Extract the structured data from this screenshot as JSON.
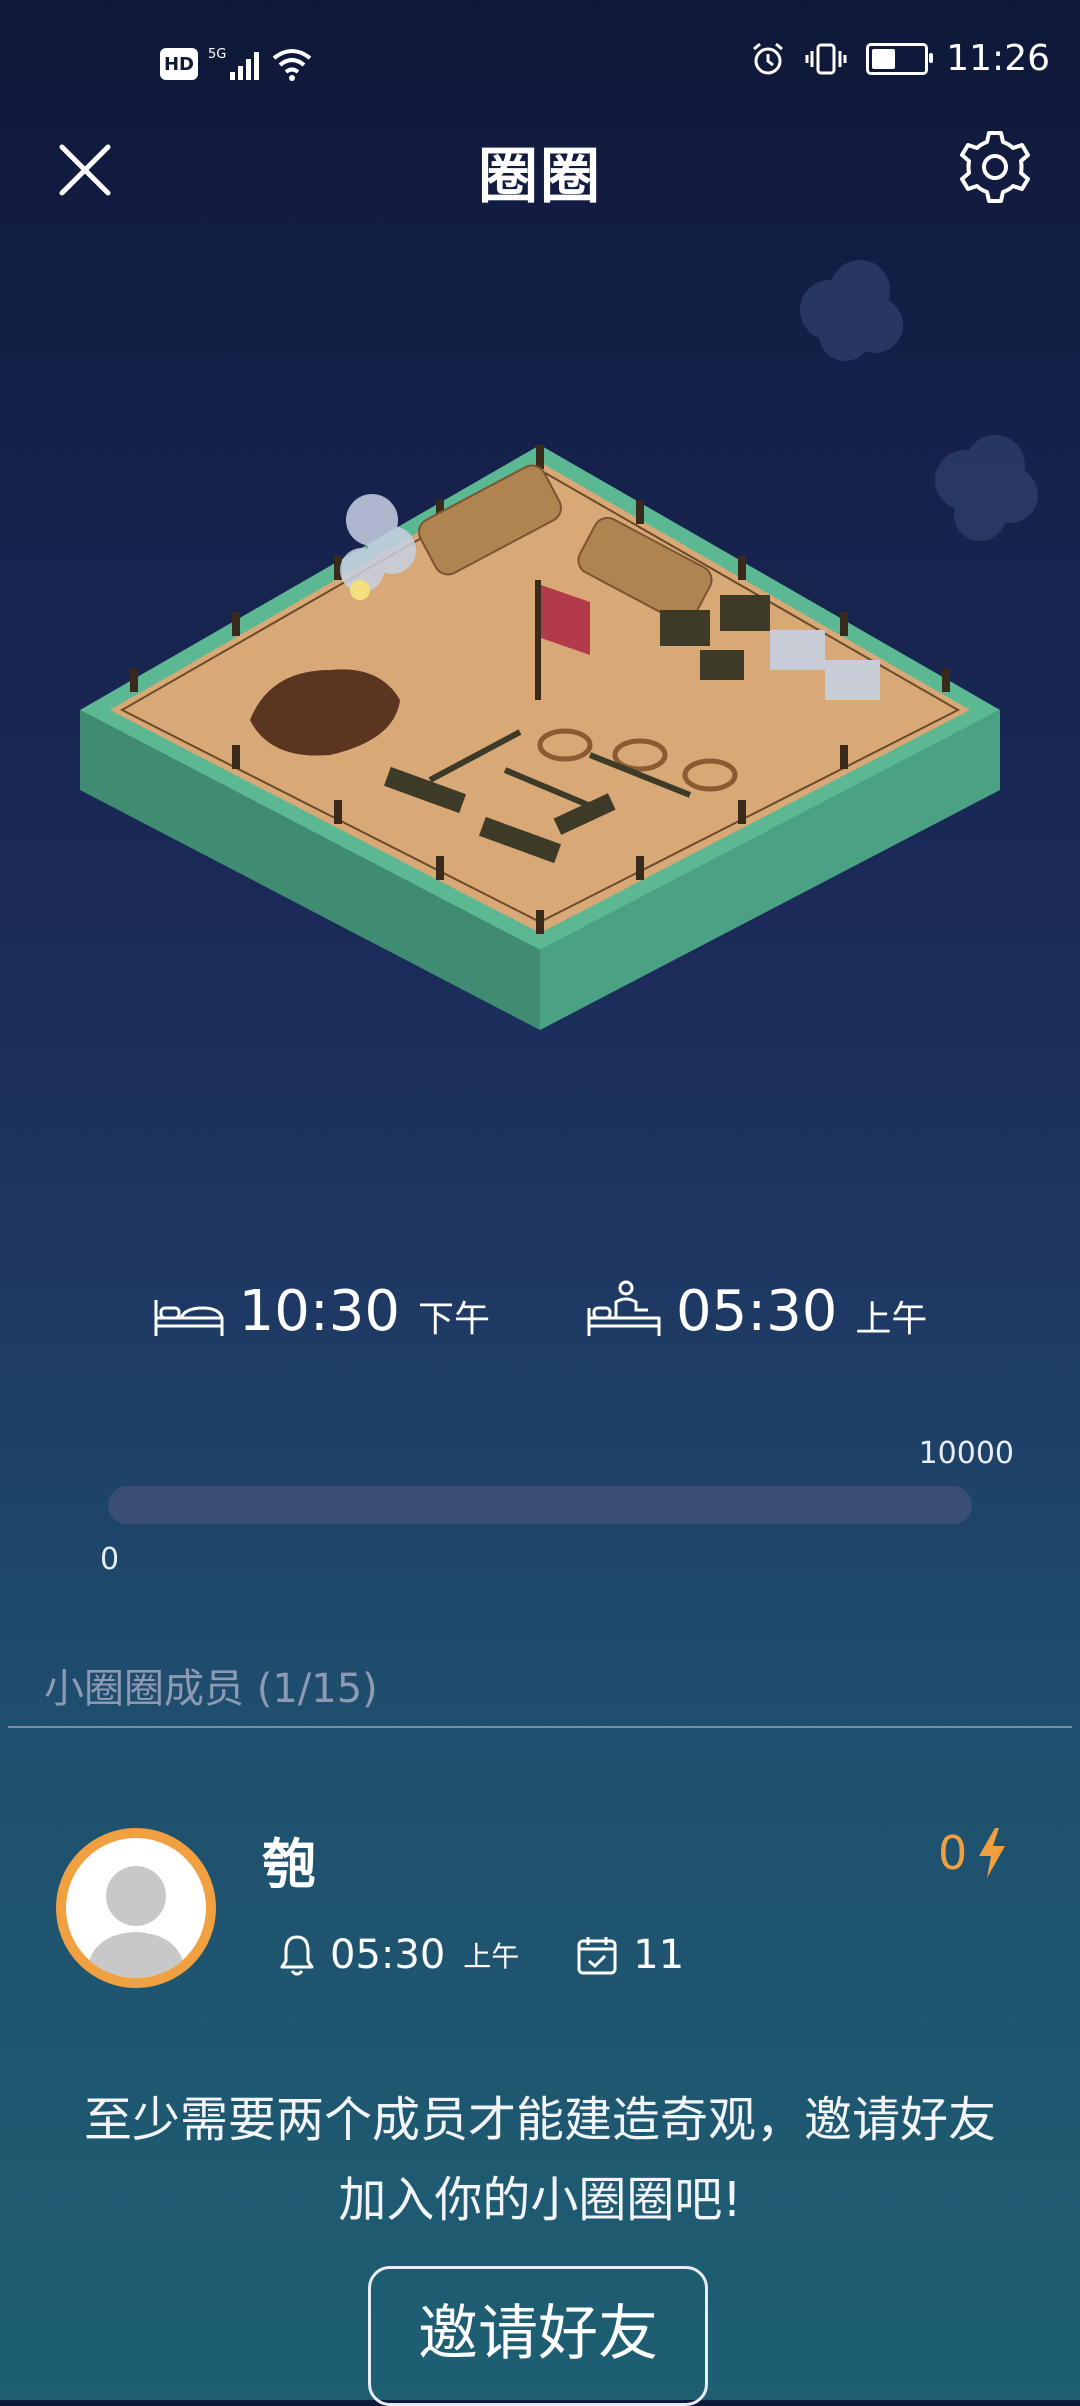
{
  "status_bar": {
    "hd_label": "HD",
    "network": "5G",
    "time": "11:26",
    "battery_level": 0.45
  },
  "header": {
    "title": "圈圈",
    "close_icon": "close-icon",
    "settings_icon": "gear-icon"
  },
  "sleep": {
    "bedtime": {
      "time": "10:30",
      "ampm": "下午",
      "icon": "bed-icon"
    },
    "wakeup": {
      "time": "05:30",
      "ampm": "上午",
      "icon": "wake-up-icon"
    }
  },
  "progress": {
    "min_label": "0",
    "max_label": "10000",
    "value": 0
  },
  "members": {
    "title": "小圈圈成员 (1/15)",
    "list": [
      {
        "name": "匏",
        "energy": "0",
        "alarm_time": "05:30",
        "alarm_ampm": "上午",
        "days": "11"
      }
    ]
  },
  "notice_line1": "至少需要两个成员才能建造奇观，邀请好友",
  "notice_line2": "加入你的小圈圈吧!",
  "invite_button": "邀请好友",
  "colors": {
    "accent": "#f0a040",
    "background_top": "#0e1838",
    "background_bottom": "#1e5f72"
  }
}
